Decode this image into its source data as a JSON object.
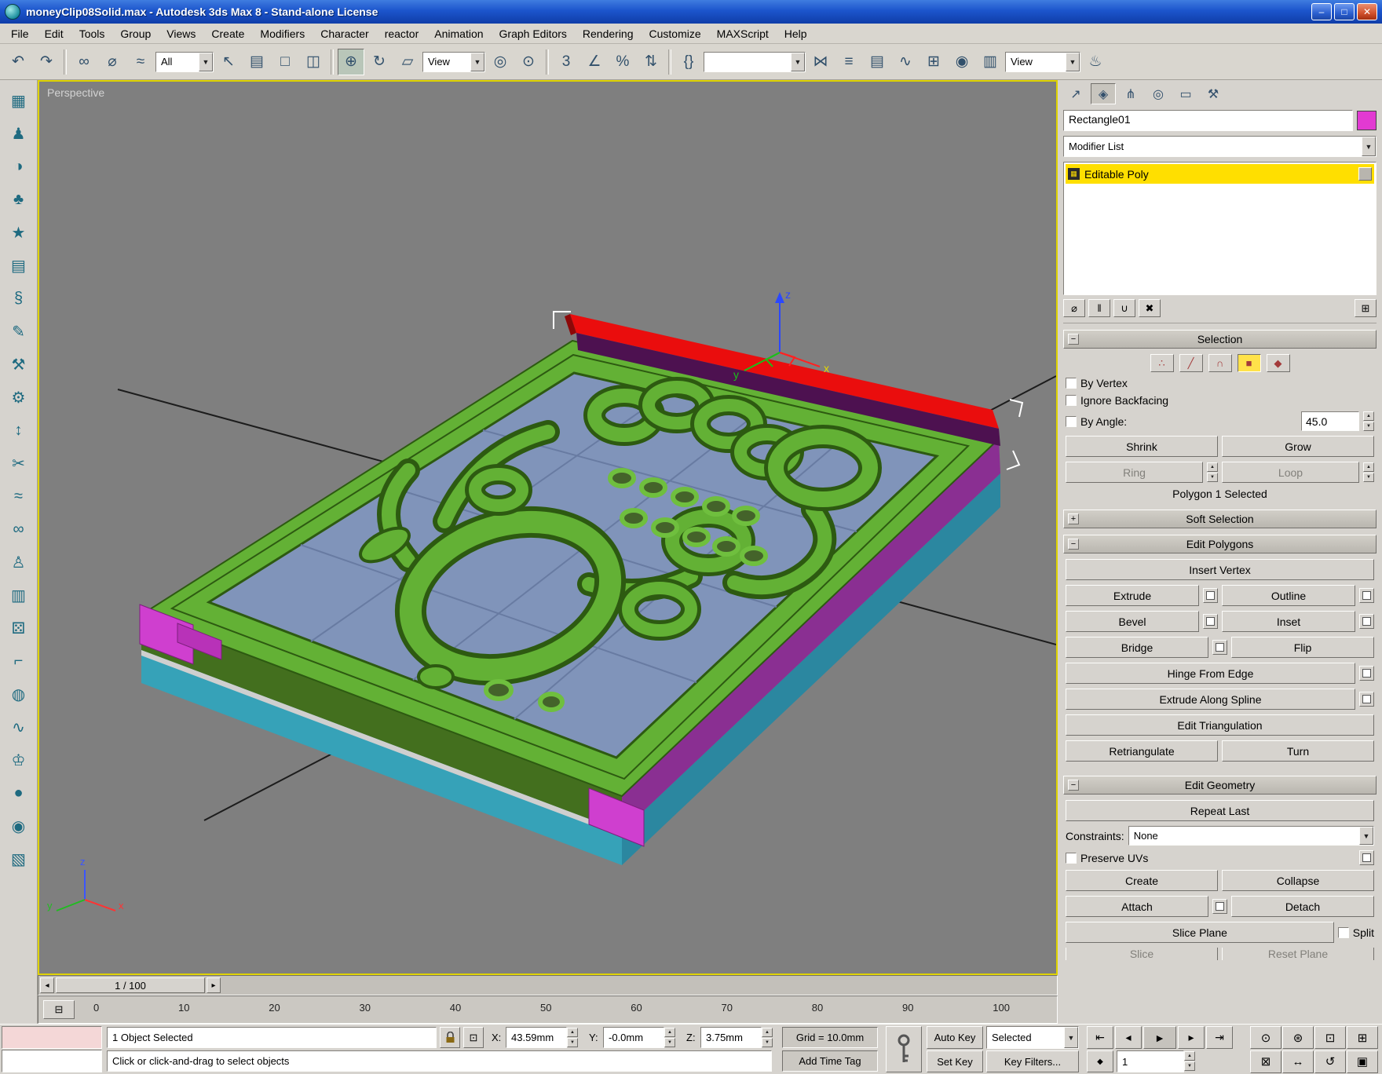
{
  "window": {
    "title": "moneyClip08Solid.max - Autodesk 3ds Max 8  - Stand-alone License",
    "minimize": "–",
    "maximize": "□",
    "close": "✕"
  },
  "menu": {
    "items": [
      "File",
      "Edit",
      "Tools",
      "Group",
      "Views",
      "Create",
      "Modifiers",
      "Character",
      "reactor",
      "Animation",
      "Graph Editors",
      "Rendering",
      "Customize",
      "MAXScript",
      "Help"
    ]
  },
  "toolbar": {
    "filter": "All",
    "ref_coord": "View",
    "named_sets": "",
    "view": "View",
    "g1": [
      {
        "n": "undo-button",
        "i": "undo-icon",
        "g": "↶"
      },
      {
        "n": "redo-button",
        "i": "redo-icon",
        "g": "↷"
      }
    ],
    "g2": [
      {
        "n": "select-and-link-button",
        "i": "link-icon",
        "g": "∞"
      },
      {
        "n": "unlink-selection-button",
        "i": "unlink-icon",
        "g": "⌀"
      },
      {
        "n": "bind-to-space-warp-button",
        "i": "space-warp-icon",
        "g": "≈"
      }
    ],
    "g3": [
      {
        "n": "select-object-button",
        "i": "cursor-arrow-icon",
        "g": "↖"
      },
      {
        "n": "select-by-name-button",
        "i": "select-by-name-icon",
        "g": "▤"
      },
      {
        "n": "rectangular-selection-button",
        "i": "rect-region-icon",
        "g": "□"
      },
      {
        "n": "window-crossing-button",
        "i": "window-crossing-icon",
        "g": "◫"
      }
    ],
    "move": {
      "n": "select-and-move-button",
      "i": "move-icon",
      "g": "⊕"
    },
    "g4": [
      {
        "n": "select-and-rotate-button",
        "i": "rotate-icon",
        "g": "↻"
      },
      {
        "n": "select-and-scale-button",
        "i": "scale-icon",
        "g": "▱"
      }
    ],
    "g5": [
      {
        "n": "use-pivot-center-button",
        "i": "pivot-center-icon",
        "g": "◎"
      },
      {
        "n": "select-and-manipulate-button",
        "i": "manipulate-icon",
        "g": "⊙"
      }
    ],
    "g6": [
      {
        "n": "snap-toggle-button",
        "i": "snap-3d-icon",
        "g": "3"
      },
      {
        "n": "angle-snap-button",
        "i": "angle-snap-icon",
        "g": "∠"
      },
      {
        "n": "percent-snap-button",
        "i": "percent-snap-icon",
        "g": "%"
      },
      {
        "n": "spinner-snap-button",
        "i": "spinner-snap-icon",
        "g": "⇅"
      }
    ],
    "g7": [
      {
        "n": "edit-named-selections-button",
        "i": "named-selection-icon",
        "g": "{}"
      }
    ],
    "g8": [
      {
        "n": "mirror-button",
        "i": "mirror-icon",
        "g": "⋈"
      },
      {
        "n": "align-button",
        "i": "align-icon",
        "g": "≡"
      },
      {
        "n": "layer-manager-button",
        "i": "layers-icon",
        "g": "▤"
      },
      {
        "n": "curve-editor-button",
        "i": "curve-editor-icon",
        "g": "∿"
      },
      {
        "n": "schematic-view-button",
        "i": "schematic-view-icon",
        "g": "⊞"
      },
      {
        "n": "material-editor-button",
        "i": "material-editor-icon",
        "g": "◉"
      },
      {
        "n": "render-scene-button",
        "i": "render-scene-icon",
        "g": "▥"
      }
    ],
    "g9": [
      {
        "n": "quick-render-button",
        "i": "teapot-icon",
        "g": "♨"
      }
    ]
  },
  "left_toolbar": {
    "icons": [
      {
        "i": "primitives-tool-icon",
        "g": "▦"
      },
      {
        "i": "figure-tool-icon",
        "g": "♟"
      },
      {
        "i": "sphere-tool-icon",
        "g": "◑"
      },
      {
        "i": "spinner-top-tool-icon",
        "g": "♣"
      },
      {
        "i": "star-tool-icon",
        "g": "★"
      },
      {
        "i": "panel-tool-icon",
        "g": "▤"
      },
      {
        "i": "spring-tool-icon",
        "g": "§"
      },
      {
        "i": "pencil-tool-icon",
        "g": "✎"
      },
      {
        "i": "hammer-tool-icon",
        "g": "⚒"
      },
      {
        "i": "gear-tool-icon",
        "g": "⚙"
      },
      {
        "i": "updown-tool-icon",
        "g": "↕"
      },
      {
        "i": "scissors-tool-icon",
        "g": "✂"
      },
      {
        "i": "waves-tool-icon",
        "g": "≈"
      },
      {
        "i": "rings-tool-icon",
        "g": "∞"
      },
      {
        "i": "pawn-tool-icon",
        "g": "♙"
      },
      {
        "i": "sheet-tool-icon",
        "g": "▥"
      },
      {
        "i": "dice-tool-icon",
        "g": "⚄"
      },
      {
        "i": "angle-tool-icon",
        "g": "⌐"
      },
      {
        "i": "wheel-tool-icon",
        "g": "◍"
      },
      {
        "i": "wave-tool-icon",
        "g": "∿"
      },
      {
        "i": "king-tool-icon",
        "g": "♔"
      },
      {
        "i": "ball-tool-icon",
        "g": "●"
      },
      {
        "i": "target-tool-icon",
        "g": "◉"
      },
      {
        "i": "texture-tool-icon",
        "g": "▧"
      }
    ]
  },
  "viewport": {
    "label": "Perspective",
    "axes": {
      "x": "x",
      "y": "y",
      "z": "z"
    }
  },
  "command_panel": {
    "tabs": [
      {
        "i": "create-tab-icon",
        "g": "↗"
      },
      {
        "i": "modify-tab-icon",
        "g": "◈"
      },
      {
        "i": "hierarchy-tab-icon",
        "g": "⋔"
      },
      {
        "i": "motion-tab-icon",
        "g": "◎"
      },
      {
        "i": "display-tab-icon",
        "g": "▭"
      },
      {
        "i": "utilities-tab-icon",
        "g": "⚒"
      }
    ],
    "object_name": "Rectangle01",
    "modifier_list": "Modifier List",
    "stack_item": "Editable Poly",
    "stack_tools": [
      {
        "i": "pin-stack-icon",
        "g": "⌀"
      },
      {
        "i": "show-end-result-icon",
        "g": "‖"
      },
      {
        "i": "make-unique-icon",
        "g": "∪"
      },
      {
        "i": "remove-modifier-icon",
        "g": "✖"
      },
      {
        "i": "configure-modifier-sets-icon",
        "g": "⊞"
      }
    ],
    "selection": {
      "title": "Selection",
      "modes": [
        {
          "g": "∴"
        },
        {
          "g": "╱"
        },
        {
          "g": "∩"
        },
        {
          "g": "■"
        },
        {
          "g": "◆"
        }
      ],
      "by_vertex": "By Vertex",
      "ignore_backfacing": "Ignore Backfacing",
      "by_angle": "By Angle:",
      "angle_value": "45.0",
      "shrink": "Shrink",
      "grow": "Grow",
      "ring": "Ring",
      "loop": "Loop",
      "status": "Polygon 1 Selected"
    },
    "soft_selection": {
      "title": "Soft Selection"
    },
    "edit_polygons": {
      "title": "Edit Polygons",
      "insert_vertex": "Insert Vertex",
      "extrude": "Extrude",
      "outline": "Outline",
      "bevel": "Bevel",
      "inset": "Inset",
      "bridge": "Bridge",
      "flip": "Flip",
      "hinge_from_edge": "Hinge From Edge",
      "extrude_along_spline": "Extrude Along Spline",
      "edit_triangulation": "Edit Triangulation",
      "retriangulate": "Retriangulate",
      "turn": "Turn"
    },
    "edit_geometry": {
      "title": "Edit Geometry",
      "repeat_last": "Repeat Last",
      "constraints": "Constraints:",
      "constraints_value": "None",
      "preserve_uvs": "Preserve UVs",
      "create": "Create",
      "collapse": "Collapse",
      "attach": "Attach",
      "detach": "Detach",
      "slice_plane": "Slice Plane",
      "split": "Split",
      "slice": "Slice",
      "reset_plane": "Reset Plane"
    }
  },
  "timeline": {
    "frame_display": "1 / 100",
    "prev": "◂",
    "next": "▸",
    "ticks": [
      "0",
      "10",
      "20",
      "30",
      "40",
      "50",
      "60",
      "70",
      "80",
      "90",
      "100"
    ]
  },
  "status_bar": {
    "selection_status": "1 Object Selected",
    "x_label": "X:",
    "x_value": "43.59mm",
    "y_label": "Y:",
    "y_value": "-0.0mm",
    "z_label": "Z:",
    "z_value": "3.75mm",
    "grid": "Grid = 10.0mm",
    "prompt": "Click or click-and-drag to select objects",
    "add_time_tag": "Add Time Tag",
    "auto_key": "Auto Key",
    "set_key": "Set Key",
    "key_mode": "Selected",
    "key_filters": "Key Filters...",
    "current_frame": "1",
    "playback": {
      "start": "⇤",
      "prev": "◂",
      "play": "►",
      "next": "▸",
      "end": "⇥",
      "step": "◆"
    },
    "nav": [
      {
        "n": "zoom-button",
        "i": "zoom-icon",
        "g": "⊙"
      },
      {
        "n": "zoom-all-button",
        "i": "zoom-all-icon",
        "g": "⊛"
      },
      {
        "n": "zoom-extents-button",
        "i": "zoom-extents-icon",
        "g": "⊡"
      },
      {
        "n": "zoom-extents-all-button",
        "i": "zoom-extents-all-icon",
        "g": "⊞"
      },
      {
        "n": "zoom-region-button",
        "i": "zoom-region-icon",
        "g": "⊠"
      },
      {
        "n": "pan-button",
        "i": "pan-hand-icon",
        "g": "↔"
      },
      {
        "n": "arc-rotate-button",
        "i": "orbit-icon",
        "g": "↺"
      },
      {
        "n": "maximize-viewport-button",
        "i": "maximize-viewport-icon",
        "g": "▣"
      }
    ]
  },
  "colors": {
    "selected_polygon_red": "#ea0d0d",
    "plate_green": "#63b135",
    "plate_side_green": "#436f1e",
    "under_plate_blue": "#8094ba",
    "clip_teal": "#36a2b8",
    "clip_teal_dark": "#2b87a0",
    "clip_purple": "#8a2f92",
    "clip_magenta": "#cf3fcf",
    "object_color_swatch": "#e23ad2",
    "stack_highlight_yellow": "#ffdf00",
    "active_viewport_border": "#dfd300",
    "subobject_active_yellow": "#ffe24a"
  }
}
